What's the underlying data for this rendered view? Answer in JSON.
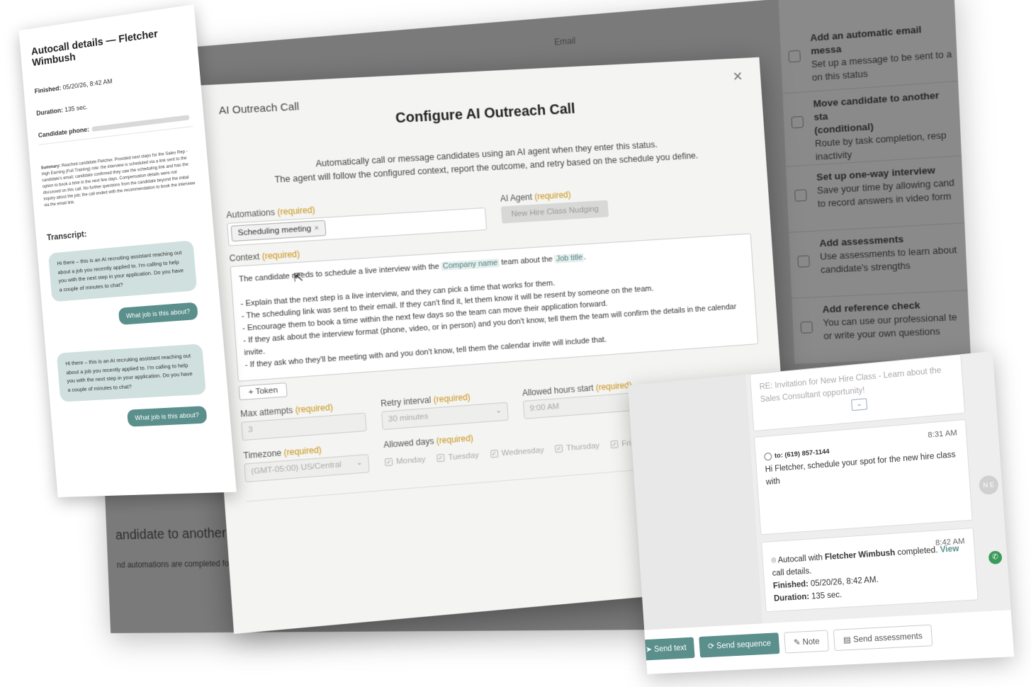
{
  "back": {
    "top_tab": "Email",
    "status_heading": "andidate to another status",
    "status_sub": "nd automations are completed for the",
    "right_panel": [
      {
        "title": "Add an automatic email messa",
        "desc": "Set up a message to be sent to a\non this status"
      },
      {
        "title": "Move candidate to another sta\n(conditional)",
        "desc": "Route by task completion, resp\ninactivity"
      },
      {
        "title": "Set up one-way interview",
        "desc": "Save your time by allowing cand\nto record answers in video form"
      },
      {
        "title": "Add assessments",
        "desc": "Use assessments to learn about\ncandidate's strengths"
      },
      {
        "title": "Add reference check",
        "desc": "You can use our professional te\nor write your own questions"
      }
    ]
  },
  "details": {
    "title": "Autocall details — Fletcher Wimbush",
    "finished_label": "Finished:",
    "finished_value": "05/20/26, 8:42 AM",
    "duration_label": "Duration:",
    "duration_value": "135 sec.",
    "phone_label": "Candidate phone:",
    "summary_label": "Summary:",
    "summary_text": "Reached candidate Fletcher. Provided next steps for the Sales Rep - High Earning (Full Training) role: the interview is scheduled via a link sent to the candidate's email; candidate confirmed they saw the scheduling link and has the option to book a time in the next few days. Compensation details were not discussed on this call. No further questions from the candidate beyond the initial inquiry about the job; the call ended with the recommendation to book the interview via the email link.",
    "transcript_label": "Transcript:",
    "transcript": [
      {
        "in": "Hi there – this is an AI recruiting assistant reaching out about a job you recently applied to. I'm calling to help you with the next step in your application. Do you have a couple of minutes to chat?",
        "out": "What job is this about?"
      },
      {
        "in": "Hi there – this is an AI recruiting assistant reaching out about a job you recently applied to. I'm calling to help you with the next step in your application. Do you have a couple of minutes to chat?",
        "out": "What job is this about?"
      }
    ]
  },
  "modal": {
    "small_title": "AI Outreach Call",
    "title": "Configure AI Outreach Call",
    "desc_line1": "Automatically call or message candidates using an AI agent when they enter this status.",
    "desc_line2": "The agent will follow the configured context, report the outcome, and retry based on the schedule you define.",
    "required": "(required)",
    "automations_label": "Automations",
    "automation_chip": "Scheduling meeting",
    "ai_agent_label": "AI Agent",
    "ai_agent_value": "New Hire Class Nudging",
    "context_label": "Context",
    "context_intro_a": "The candidate needs to schedule a live interview with the ",
    "context_token1": "Company name",
    "context_intro_b": " team about the ",
    "context_token2": "Job title",
    "context_intro_c": ".",
    "context_bullets": [
      "- Explain that the next step is a live interview, and they can pick a time that works for them.",
      "- The scheduling link was sent to their email. If they can't find it, let them know it will be resent by someone on the team.",
      "- Encourage them to book a time within the next few days so the team can move their application forward.",
      "- If they ask about the interview format (phone, video, or in person) and you don't know, tell them the team will confirm the details in the calendar invite.",
      "- If they ask who they'll be meeting with and you don't know, tell them the calendar invite will include that."
    ],
    "token_button": "Token",
    "max_attempts_label": "Max attempts",
    "max_attempts_value": "3",
    "retry_label": "Retry interval",
    "retry_value": "30 minutes",
    "hours_label": "Allowed hours start",
    "hours_value": "9:00 AM",
    "timezone_label": "Timezone",
    "timezone_value": "(GMT-05:00) US/Central",
    "days_label": "Allowed days",
    "days": [
      "Monday",
      "Tuesday",
      "Wednesday",
      "Thursday",
      "Fri"
    ]
  },
  "messages": {
    "email_card_text": "RE: Invitation for New Hire Class - Learn about the Sales Consultant opportunity!",
    "sms_time": "8:31 AM",
    "sms_to": "to: (619) 857-1144",
    "sms_text": "Hi Fletcher, schedule your spot for the new hire class with",
    "call_time": "8:42 AM",
    "call_text_a": "Autocall with ",
    "call_name": "Fletcher Wimbush",
    "call_text_b": " completed. ",
    "call_link": "View",
    "call_text_c": " call details.",
    "finished_label": "Finished:",
    "finished_value": "05/20/26, 8:42 AM.",
    "duration_label": "Duration:",
    "duration_value": "135 sec.",
    "avatar_initials": "N E",
    "actions": {
      "send_text": "Send text",
      "send_sequence": "Send sequence",
      "note": "Note",
      "send_assessments": "Send assessments"
    }
  }
}
